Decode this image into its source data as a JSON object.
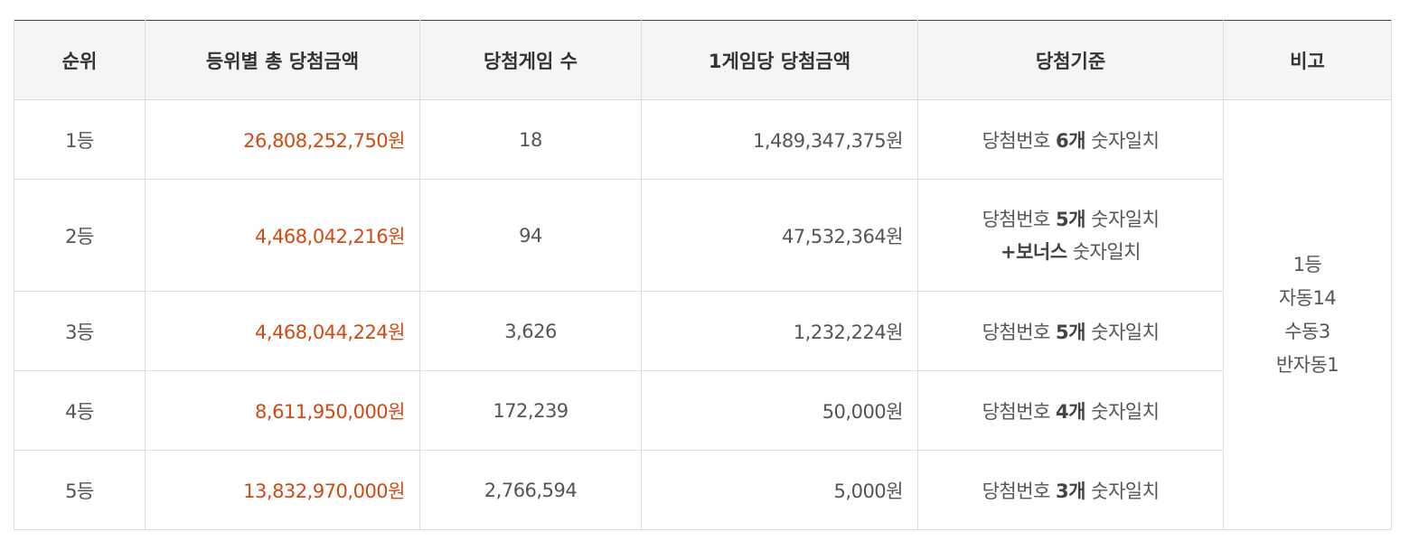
{
  "headers": [
    "순위",
    "등위별 총 당첨금액",
    "당첨게임 수",
    "1게임당 당첨금액",
    "당첨기준",
    "비고"
  ],
  "rows": [
    {
      "rank": "1등",
      "total": "26,808,252,750원",
      "games": "18",
      "per_game": "1,489,347,375원",
      "criteria": {
        "prefix": "당첨번호 ",
        "count": "6개",
        "suffix": " 숫자일치"
      }
    },
    {
      "rank": "2등",
      "total": "4,468,042,216원",
      "games": "94",
      "per_game": "47,532,364원",
      "criteria": {
        "prefix": "당첨번호 ",
        "count": "5개",
        "suffix": " 숫자일치",
        "line2_prefix": "+",
        "line2_bold": "보너스",
        "line2_suffix": " 숫자일치"
      }
    },
    {
      "rank": "3등",
      "total": "4,468,044,224원",
      "games": "3,626",
      "per_game": "1,232,224원",
      "criteria": {
        "prefix": "당첨번호 ",
        "count": "5개",
        "suffix": " 숫자일치"
      }
    },
    {
      "rank": "4등",
      "total": "8,611,950,000원",
      "games": "172,239",
      "per_game": "50,000원",
      "criteria": {
        "prefix": "당첨번호 ",
        "count": "4개",
        "suffix": " 숫자일치"
      }
    },
    {
      "rank": "5등",
      "total": "13,832,970,000원",
      "games": "2,766,594",
      "per_game": "5,000원",
      "criteria": {
        "prefix": "당첨번호 ",
        "count": "3개",
        "suffix": " 숫자일치"
      }
    }
  ],
  "note": [
    "1등",
    "자동14",
    "수동3",
    "반자동1"
  ],
  "colors": {
    "amount": "#d14a12",
    "header_bg": "#f5f5f5",
    "border": "#dddddd",
    "top_border": "#444444"
  }
}
